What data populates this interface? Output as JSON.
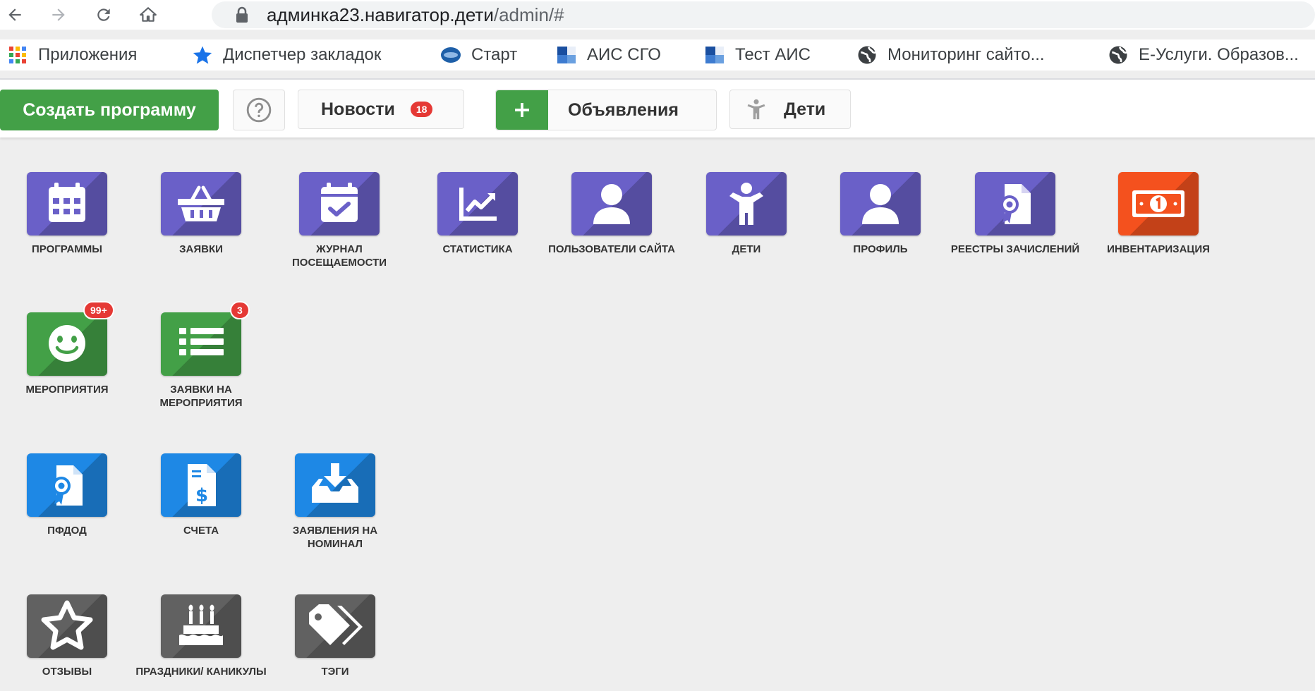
{
  "browser": {
    "url_host": "админка23.навигатор.дети",
    "url_path": "/admin/#"
  },
  "bookmarks": [
    {
      "label": "Приложения",
      "icon": "apps-grid-icon"
    },
    {
      "label": "Диспетчер закладок",
      "icon": "star-icon"
    },
    {
      "label": "Старт",
      "icon": "start-logo-icon"
    },
    {
      "label": "АИС СГО",
      "icon": "ais-icon"
    },
    {
      "label": "Тест АИС",
      "icon": "ais-icon"
    },
    {
      "label": "Мониторинг сайто...",
      "icon": "globe-icon"
    },
    {
      "label": "Е-Услуги. Образов...",
      "icon": "globe-icon"
    }
  ],
  "toolbar": {
    "create_label": "Создать программу",
    "news_label": "Новости",
    "news_count": "18",
    "ads_label": "Объявления",
    "children_label": "Дети"
  },
  "tiles": [
    {
      "label": "ПРОГРАММЫ",
      "color": "#6a60c8",
      "icon": "calendar-icon"
    },
    {
      "label": "ЗАЯВКИ",
      "color": "#6a60c8",
      "icon": "basket-icon"
    },
    {
      "label": "ЖУРНАЛ ПОСЕЩАЕМОСТИ",
      "color": "#6a60c8",
      "icon": "calendar-check-icon"
    },
    {
      "label": "СТАТИСТИКА",
      "color": "#6a60c8",
      "icon": "chart-line-icon"
    },
    {
      "label": "ПОЛЬЗОВАТЕЛИ САЙТА",
      "color": "#6a60c8",
      "icon": "user-icon"
    },
    {
      "label": "ДЕТИ",
      "color": "#6a60c8",
      "icon": "child-icon"
    },
    {
      "label": "ПРОФИЛЬ",
      "color": "#6a60c8",
      "icon": "user-icon"
    },
    {
      "label": "РЕЕСТРЫ ЗАЧИСЛЕНИЙ",
      "color": "#6a60c8",
      "icon": "certificate-icon"
    },
    {
      "label": "ИНВЕНТАРИЗАЦИЯ",
      "color": "#f4511e",
      "icon": "money-icon"
    },
    {
      "label": "МЕРОПРИЯТИЯ",
      "color": "#43a047",
      "icon": "smile-icon",
      "count": "99+"
    },
    {
      "label": "ЗАЯВКИ НА МЕРОПРИЯТИЯ",
      "color": "#43a047",
      "icon": "list-icon",
      "count": "3"
    },
    {
      "label": "ПФДОД",
      "color": "#1e88e5",
      "icon": "certificate-icon"
    },
    {
      "label": "СЧЕТА",
      "color": "#1e88e5",
      "icon": "invoice-icon"
    },
    {
      "label": "ЗАЯВЛЕНИЯ НА НОМИНАЛ",
      "color": "#1e88e5",
      "icon": "inbox-download-icon"
    },
    {
      "label": "ОТЗЫВЫ",
      "color": "#616161",
      "icon": "star-outline-icon"
    },
    {
      "label": "ПРАЗДНИКИ/ КАНИКУЛЫ",
      "color": "#616161",
      "icon": "cake-icon"
    },
    {
      "label": "ТЭГИ",
      "color": "#616161",
      "icon": "tags-icon"
    }
  ]
}
